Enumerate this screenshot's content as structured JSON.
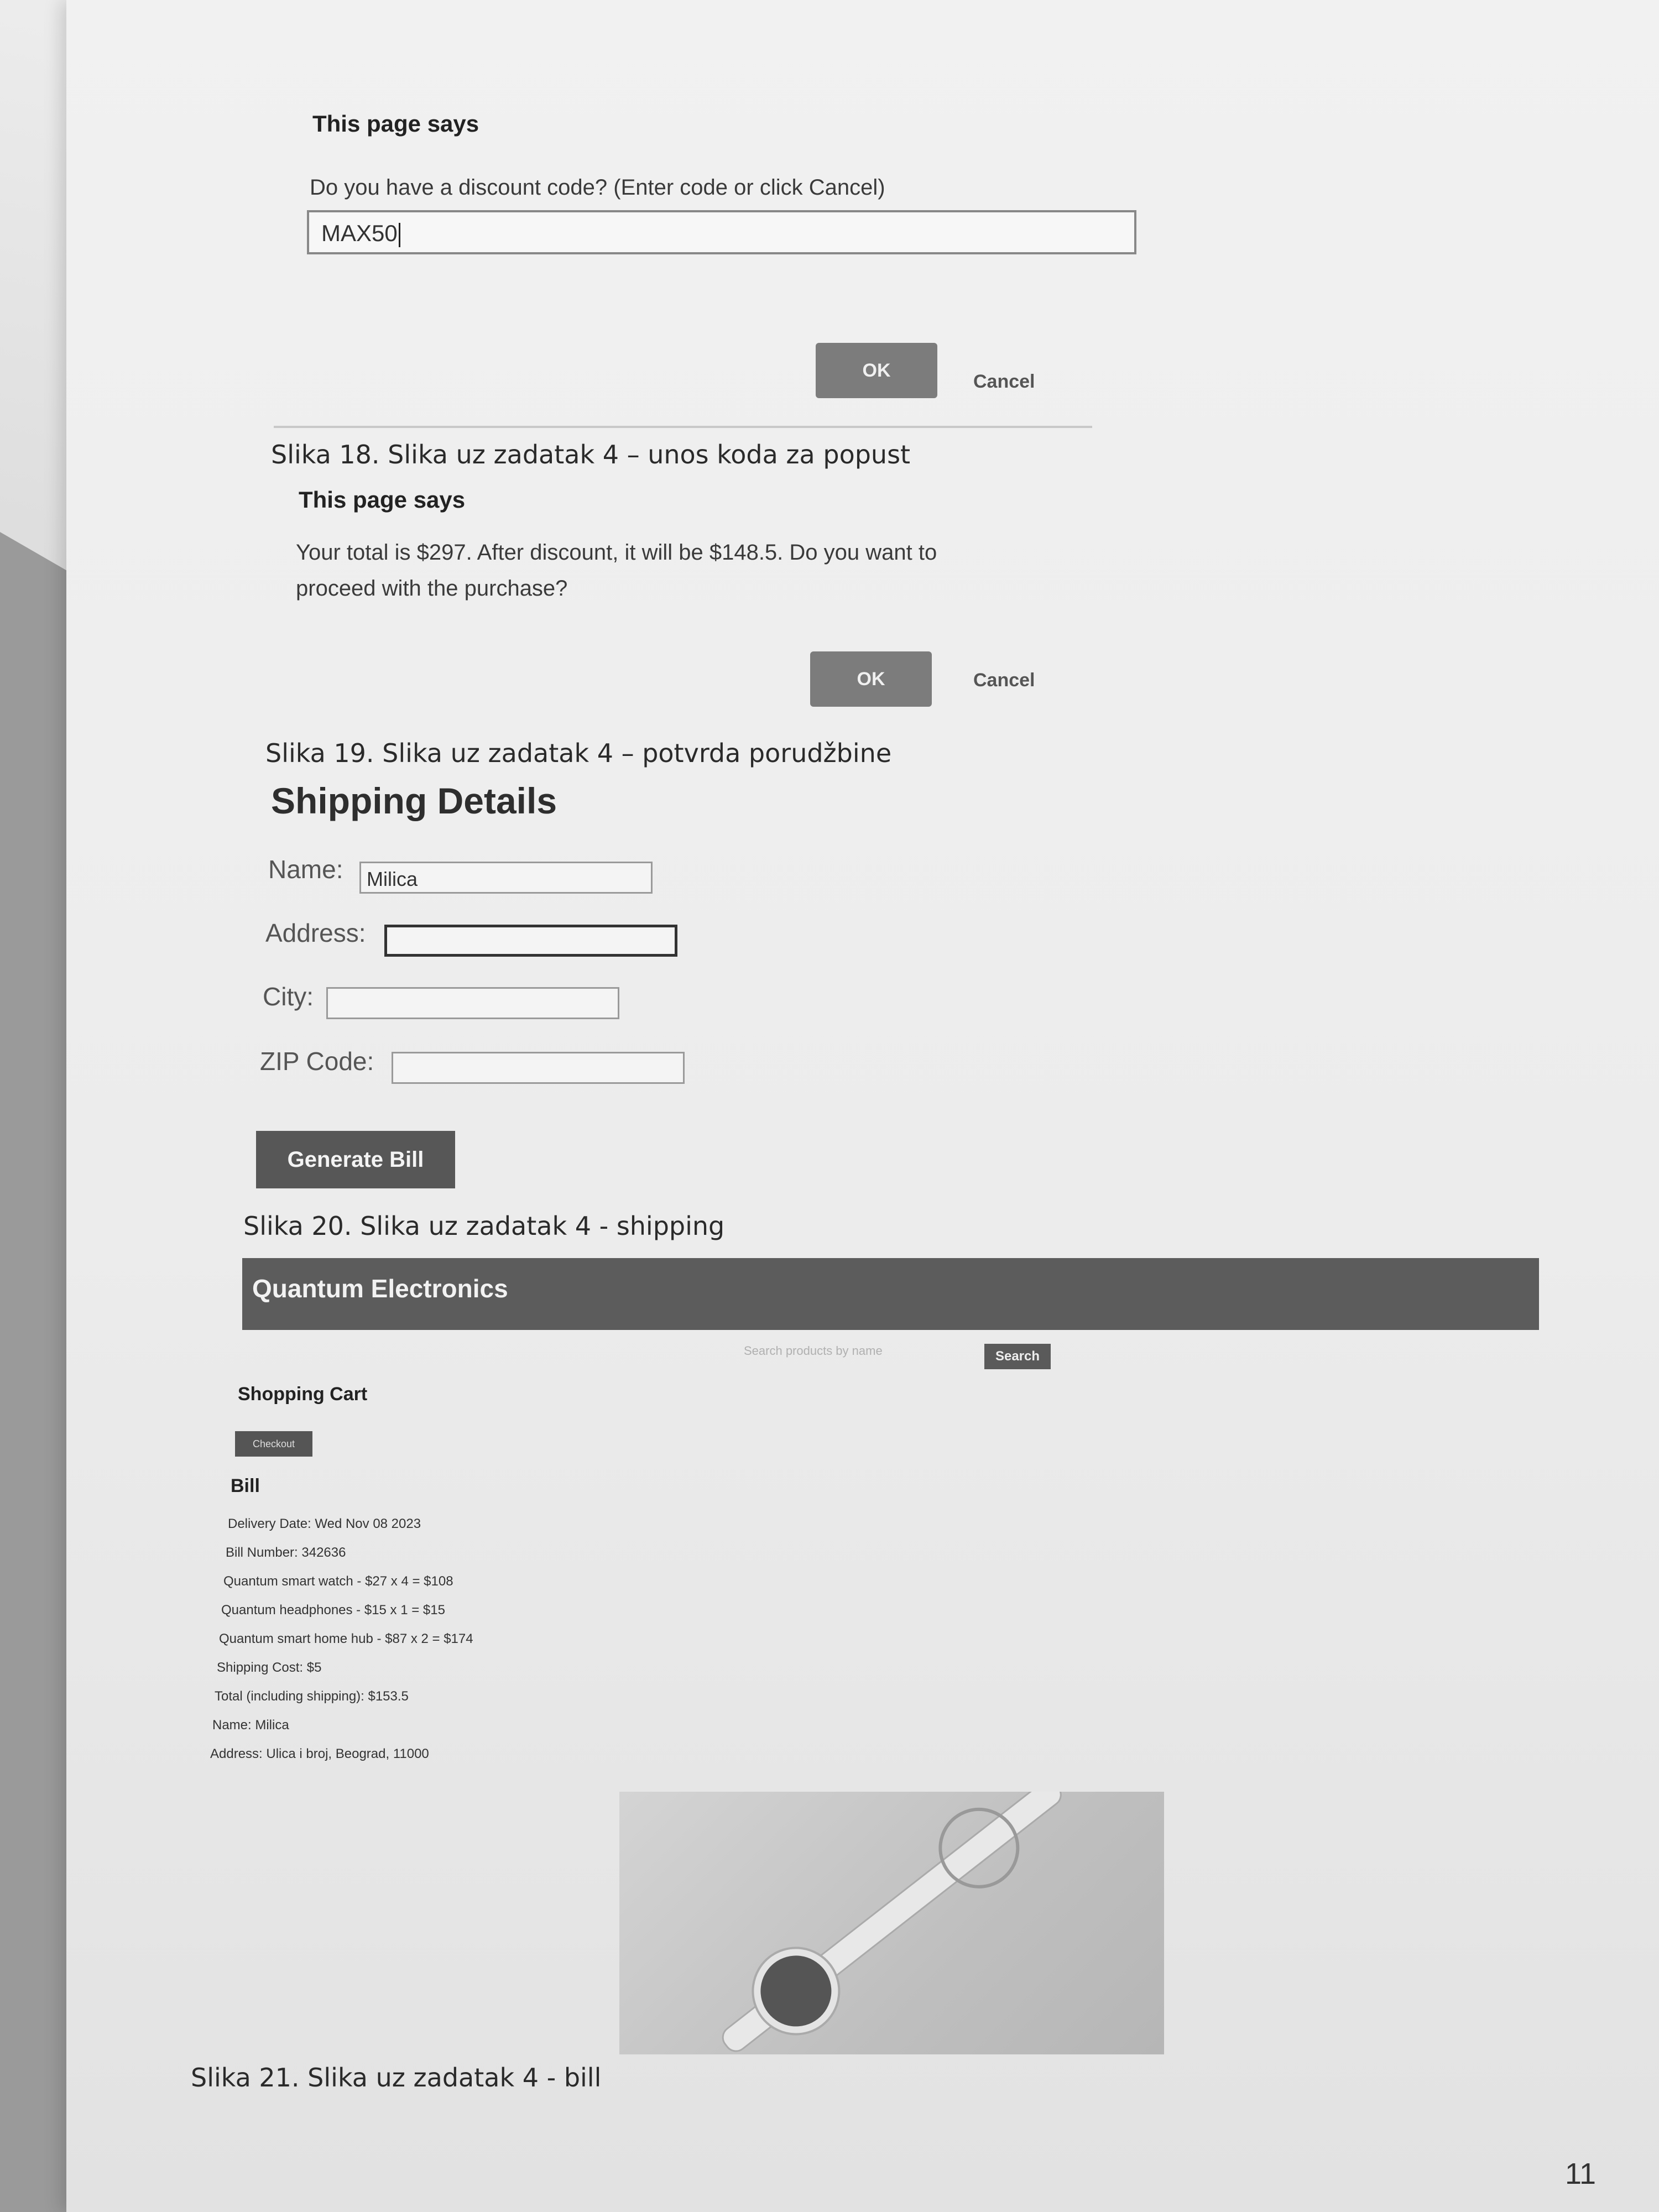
{
  "dialog1": {
    "title": "This page says",
    "message": "Do you have a discount code? (Enter code or click Cancel)",
    "input_value": "MAX50",
    "ok_label": "OK",
    "cancel_label": "Cancel"
  },
  "caption1": "Slika 18. Slika uz zadatak 4 – unos koda za popust",
  "dialog2": {
    "title": "This page says",
    "message_line1": "Your total is $297. After discount, it will be $148.5. Do you want to",
    "message_line2": "proceed with the purchase?",
    "ok_label": "OK",
    "cancel_label": "Cancel"
  },
  "caption2": "Slika 19. Slika uz zadatak 4 – potvrda porudžbine",
  "shipping": {
    "title": "Shipping Details",
    "name_label": "Name:",
    "name_value": "Milica",
    "address_label": "Address:",
    "city_label": "City:",
    "zip_label": "ZIP Code:",
    "button_label": "Generate Bill"
  },
  "caption3": "Slika 20. Slika uz zadatak 4 - shipping",
  "store": {
    "name": "Quantum Electronics",
    "search_placeholder": "Search products by name",
    "search_button": "Search",
    "cart_title": "Shopping Cart",
    "checkout_button": "Checkout"
  },
  "bill": {
    "title": "Bill",
    "lines": [
      "Delivery Date: Wed Nov 08 2023",
      "Bill Number: 342636",
      "Quantum smart watch - $27 x 4 = $108",
      "Quantum headphones - $15 x 1 = $15",
      "Quantum smart home hub - $87 x 2 = $174",
      "Shipping Cost: $5",
      "Total (including shipping): $153.5",
      "Name: Milica",
      "Address: Ulica i broj, Beograd, 11000"
    ]
  },
  "caption4": "Slika 21. Slika uz zadatak 4 - bill",
  "page_number": "11",
  "colors": {
    "button_gray": "#7c7c7c",
    "banner_gray": "#5c5c5c",
    "paper": "#ececec"
  }
}
